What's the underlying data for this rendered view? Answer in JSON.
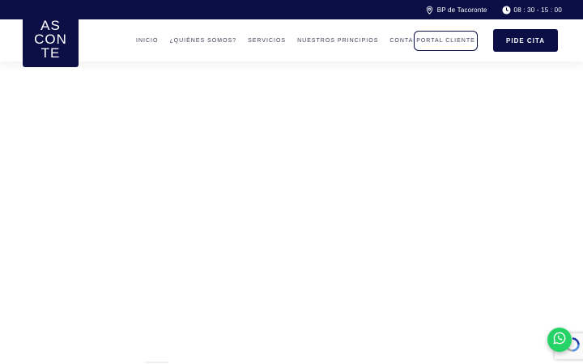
{
  "topbar": {
    "location": "BP de Tacoronte",
    "hours": "08 : 30 - 15 : 00",
    "icons": [
      "map-pin-icon",
      "clock-icon"
    ]
  },
  "logo": {
    "line1": "AS",
    "line2": "CON",
    "line3": "TE"
  },
  "nav": {
    "items": [
      {
        "label": "INICIO"
      },
      {
        "label": "¿QUIÉNES SOMOS?"
      },
      {
        "label": "SERVICIOS"
      },
      {
        "label": "NUESTROS PRINCIPIOS"
      },
      {
        "label": "CONTACTO"
      }
    ],
    "portal_label": "PORTAL CLIENTE",
    "cta_label": "PIDE CITA"
  },
  "widgets": {
    "chat_icon": "whatsapp-icon",
    "captcha_icon": "recaptcha-icon"
  },
  "colors": {
    "brand": "#0b0f45",
    "whatsapp": "#25d366",
    "nav_text": "#3c3f59"
  }
}
